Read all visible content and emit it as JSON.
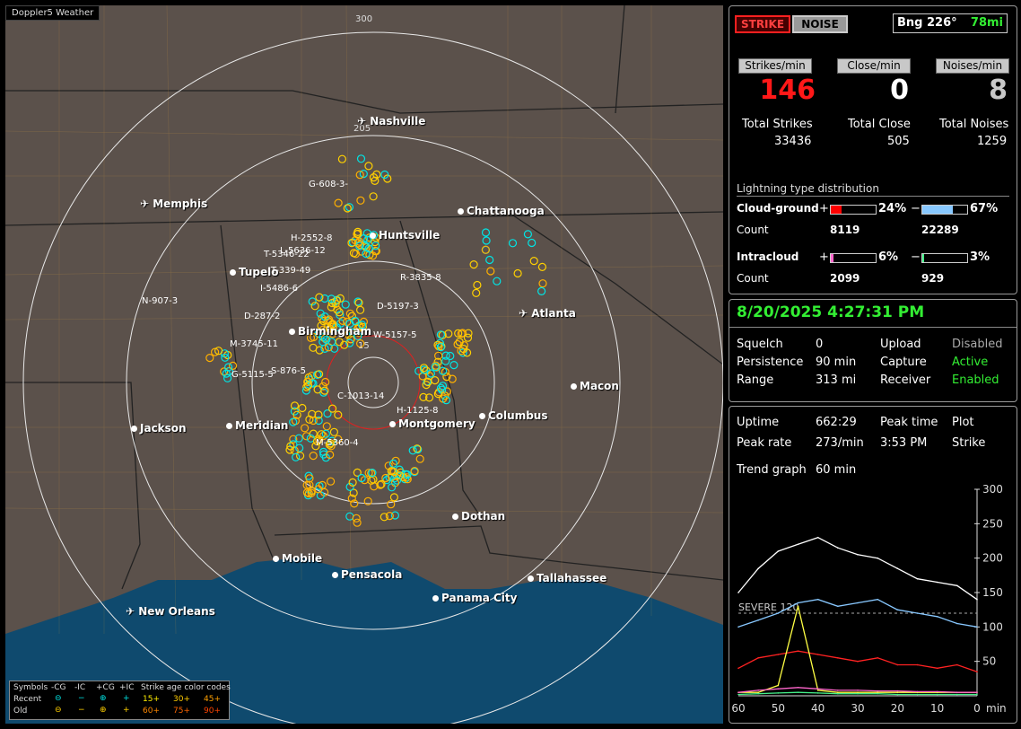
{
  "map": {
    "title": "Doppler5 Weather",
    "rings": [
      "300",
      "205",
      "15"
    ],
    "cities": [
      {
        "name": "Nashville",
        "kind": "plane"
      },
      {
        "name": "Memphis",
        "kind": "plane"
      },
      {
        "name": "Chattanooga",
        "kind": "dot"
      },
      {
        "name": "Huntsville",
        "kind": "dot"
      },
      {
        "name": "Tupelo",
        "kind": "dot"
      },
      {
        "name": "Atlanta",
        "kind": "plane"
      },
      {
        "name": "Birmingham",
        "kind": "dot"
      },
      {
        "name": "Macon",
        "kind": "dot"
      },
      {
        "name": "Jackson",
        "kind": "dot"
      },
      {
        "name": "Meridian",
        "kind": "dot"
      },
      {
        "name": "Montgomery",
        "kind": "dot"
      },
      {
        "name": "Columbus",
        "kind": "dot"
      },
      {
        "name": "Dothan",
        "kind": "dot"
      },
      {
        "name": "Mobile",
        "kind": "dot"
      },
      {
        "name": "Pensacola",
        "kind": "dot"
      },
      {
        "name": "Tallahassee",
        "kind": "dot"
      },
      {
        "name": "Panama City",
        "kind": "dot"
      },
      {
        "name": "New Orleans",
        "kind": "plane"
      }
    ],
    "cells": [
      "G-608-3-",
      "H-2552-8",
      "L-5636-12",
      "T-5346-22",
      "T-339-49",
      "I-5486-6",
      "N-907-3",
      "D-287-2",
      "R-3835-8",
      "D-5197-3",
      "M-3745-11",
      "W-5157-5",
      "S-876-5",
      "G-5115-5",
      "C-1013-14",
      "H-1125-8",
      "M-5360-4"
    ],
    "legend": {
      "symbols_label": "Symbols",
      "cols": [
        "-CG",
        "-IC",
        "+CG",
        "+IC"
      ],
      "age_label": "Strike age color codes",
      "recent_label": "Recent",
      "old_label": "Old",
      "recent_ages": [
        "15+",
        "30+",
        "45+"
      ],
      "old_ages": [
        "60+",
        "75+",
        "90+"
      ]
    }
  },
  "header": {
    "strike_button": "STRIKE",
    "noise_button": "NOISE",
    "bearing": "Bng 226°",
    "distance": "78mi"
  },
  "rates": {
    "strikes_label": "Strikes/min",
    "close_label": "Close/min",
    "noises_label": "Noises/min",
    "strikes": "146",
    "close": "0",
    "noises": "8",
    "total_strikes_label": "Total Strikes",
    "total_close_label": "Total Close",
    "total_noises_label": "Total Noises",
    "total_strikes": "33436",
    "total_close": "505",
    "total_noises": "1259"
  },
  "distribution": {
    "title": "Lightning type distribution",
    "cg_label": "Cloud-ground",
    "ic_label": "Intracloud",
    "count_label": "Count",
    "plus": "+",
    "minus": "−",
    "cg_pos_pct": "24%",
    "cg_neg_pct": "67%",
    "ic_pos_pct": "6%",
    "ic_neg_pct": "3%",
    "cg_pos_frac": 0.24,
    "cg_neg_frac": 0.67,
    "ic_pos_frac": 0.06,
    "ic_neg_frac": 0.03,
    "cg_pos_count": "8119",
    "cg_neg_count": "22289",
    "ic_pos_count": "2099",
    "ic_neg_count": "929",
    "colors": {
      "cg_pos": "#ff0000",
      "cg_neg": "#88c8ff",
      "ic_pos": "#ff66cc",
      "ic_neg": "#44ee88"
    }
  },
  "status": {
    "datetime": "8/20/2025 4:27:31 PM",
    "squelch_label": "Squelch",
    "squelch": "0",
    "persistence_label": "Persistence",
    "persistence": "90 min",
    "range_label": "Range",
    "range": "313 mi",
    "upload_label": "Upload",
    "upload": "Disabled",
    "capture_label": "Capture",
    "capture": "Active",
    "receiver_label": "Receiver",
    "receiver": "Enabled"
  },
  "stats": {
    "uptime_label": "Uptime",
    "uptime": "662:29",
    "peak_time_label": "Peak time",
    "peak_time": "3:53 PM",
    "plot_label": "Plot",
    "plot": "Strike",
    "peak_rate_label": "Peak rate",
    "peak_rate": "273/min",
    "trend_label": "Trend graph",
    "trend": "60 min"
  },
  "chart_data": {
    "type": "line",
    "x": [
      60,
      55,
      50,
      45,
      40,
      35,
      30,
      25,
      20,
      15,
      10,
      5,
      0
    ],
    "x_ticks": [
      "60",
      "50",
      "40",
      "30",
      "20",
      "10",
      "0"
    ],
    "x_unit": "min",
    "y_ticks": [
      "300",
      "250",
      "200",
      "150",
      "100",
      "50"
    ],
    "ylim": [
      0,
      300
    ],
    "threshold": {
      "label": "SEVERE 120",
      "value": 120
    },
    "series": [
      {
        "color": "#ffffff",
        "values": [
          150,
          185,
          210,
          220,
          230,
          215,
          205,
          200,
          185,
          170,
          165,
          160,
          140
        ]
      },
      {
        "color": "#88c8ff",
        "values": [
          100,
          110,
          120,
          135,
          140,
          130,
          135,
          140,
          125,
          120,
          115,
          105,
          100
        ]
      },
      {
        "color": "#ff2222",
        "values": [
          40,
          55,
          60,
          65,
          60,
          55,
          50,
          55,
          45,
          45,
          40,
          45,
          35
        ]
      },
      {
        "color": "#ffff44",
        "values": [
          5,
          5,
          15,
          130,
          8,
          5,
          5,
          5,
          5,
          5,
          5,
          5,
          5
        ]
      },
      {
        "color": "#ff66cc",
        "values": [
          5,
          8,
          10,
          12,
          10,
          8,
          8,
          7,
          7,
          6,
          6,
          5,
          5
        ]
      },
      {
        "color": "#44ee88",
        "values": [
          2,
          3,
          4,
          5,
          4,
          3,
          3,
          3,
          2,
          2,
          2,
          2,
          2
        ]
      }
    ]
  }
}
